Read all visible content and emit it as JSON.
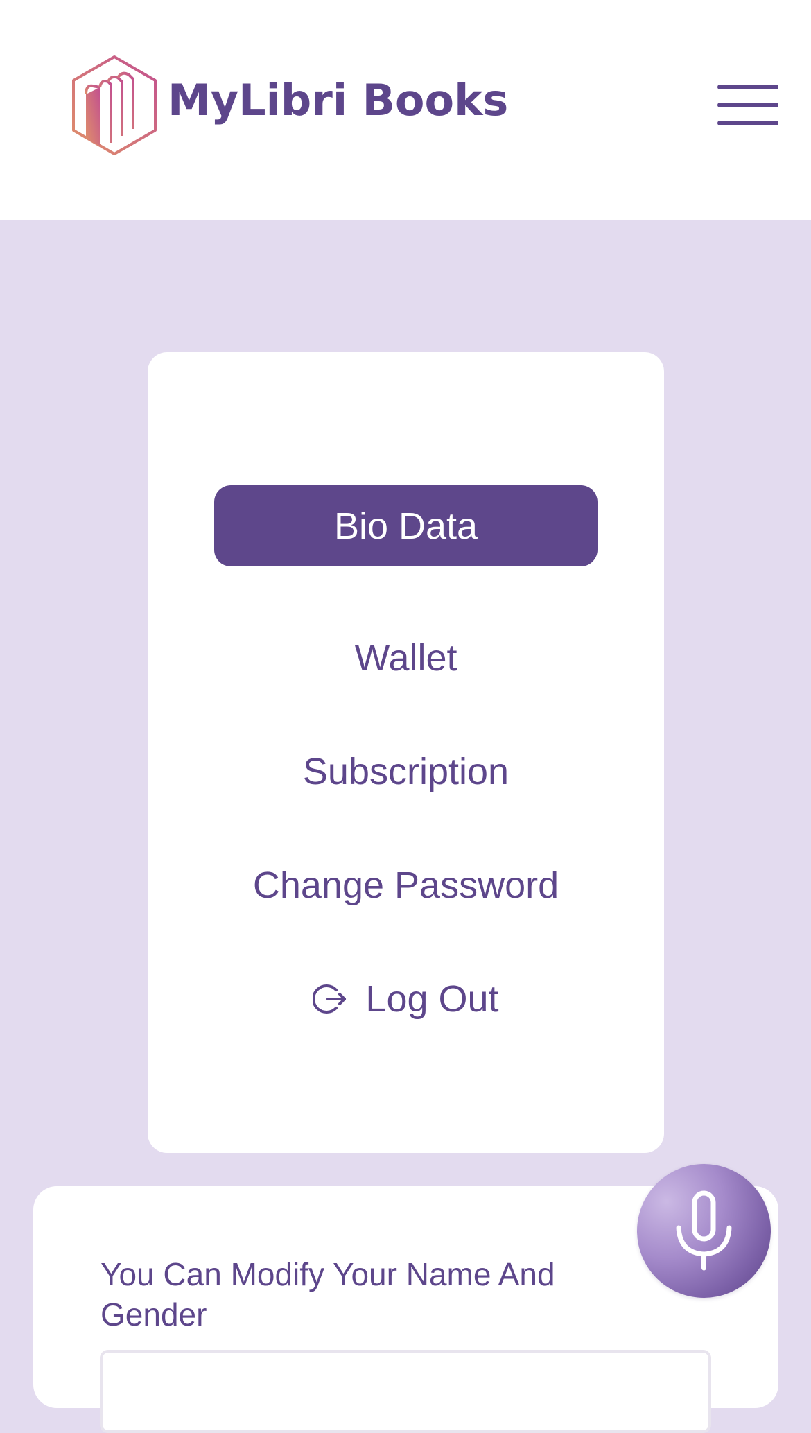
{
  "header": {
    "brand_name": "MyLibri Books",
    "logo_icon": "book-hexagon-logo",
    "menu_icon": "hamburger-menu-icon"
  },
  "profile_menu": {
    "items": [
      {
        "label": "Bio Data",
        "active": true
      },
      {
        "label": "Wallet",
        "active": false
      },
      {
        "label": "Subscription",
        "active": false
      },
      {
        "label": "Change Password",
        "active": false
      },
      {
        "label": "Log Out",
        "active": false,
        "icon": "logout-icon"
      }
    ]
  },
  "bio_form": {
    "title": "You Can Modify Your Name And Gender",
    "name_value": "",
    "name_placeholder": ""
  },
  "voice": {
    "icon": "microphone-icon"
  },
  "colors": {
    "accent": "#5e478b",
    "page_background": "#e3dbef",
    "card_background": "#ffffff",
    "logo_gradient_start": "#e0906a",
    "logo_gradient_end": "#c2508f"
  }
}
